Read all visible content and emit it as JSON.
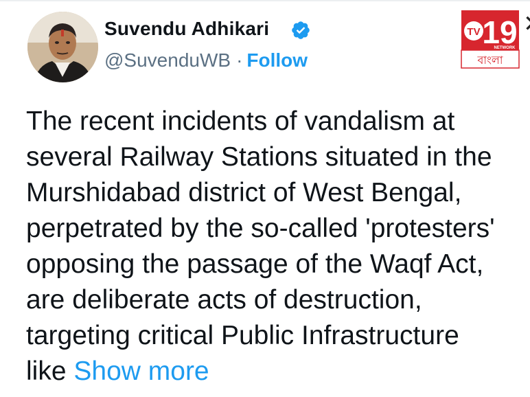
{
  "author": {
    "name": "Suvendu Adhikari",
    "handle": "@SuvenduWB",
    "separator": "·",
    "follow_label": "Follow",
    "verified_icon": "verified-badge-icon",
    "verified_color": "#1d9bf0"
  },
  "logo": {
    "brand": "TV19",
    "sub": "NETWORK",
    "script_text": "বাংলা"
  },
  "close_icon": "close-icon",
  "tweet": {
    "lines": [
      "The recent incidents of vandalism at",
      "several Railway Stations situated in the",
      "Murshidabad district of West Bengal,",
      "perpetrated by the so-called 'protesters'",
      "opposing the passage of the Waqf Act,",
      "are deliberate acts of destruction,",
      "targeting critical Public Infrastructure",
      "like"
    ],
    "show_more_label": "Show more",
    "link_color": "#1d9bf0"
  }
}
